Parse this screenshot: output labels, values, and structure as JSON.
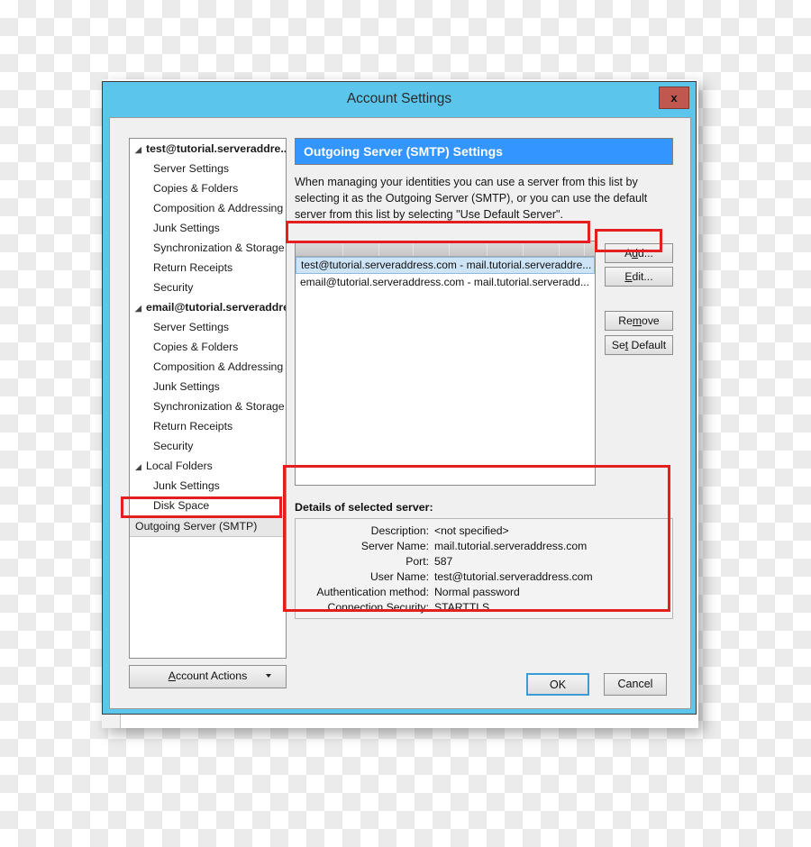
{
  "window": {
    "title": "Account Settings",
    "close_label": "x",
    "close_icon": "close-icon"
  },
  "sidebar": {
    "items": [
      {
        "label": "test@tutorial.serveraddre...",
        "type": "account",
        "twisty": "◢"
      },
      {
        "label": "Server Settings",
        "type": "child"
      },
      {
        "label": "Copies & Folders",
        "type": "child"
      },
      {
        "label": "Composition & Addressing",
        "type": "child"
      },
      {
        "label": "Junk Settings",
        "type": "child"
      },
      {
        "label": "Synchronization & Storage",
        "type": "child"
      },
      {
        "label": "Return Receipts",
        "type": "child"
      },
      {
        "label": "Security",
        "type": "child"
      },
      {
        "label": "email@tutorial.serveraddres...",
        "type": "account",
        "twisty": "◢"
      },
      {
        "label": "Server Settings",
        "type": "child"
      },
      {
        "label": "Copies & Folders",
        "type": "child"
      },
      {
        "label": "Composition & Addressing",
        "type": "child"
      },
      {
        "label": "Junk Settings",
        "type": "child"
      },
      {
        "label": "Synchronization & Storage",
        "type": "child"
      },
      {
        "label": "Return Receipts",
        "type": "child"
      },
      {
        "label": "Security",
        "type": "child"
      },
      {
        "label": "Local Folders",
        "type": "group",
        "twisty": "◢"
      },
      {
        "label": "Junk Settings",
        "type": "child"
      },
      {
        "label": "Disk Space",
        "type": "child"
      },
      {
        "label": "Outgoing Server (SMTP)",
        "type": "selected"
      }
    ],
    "account_actions": {
      "label_pre": "A",
      "label_accel": "c",
      "label_post": "count Actions",
      "full_label": "Account Actions",
      "arrow_icon": "chevron-down-icon"
    }
  },
  "main": {
    "section_title": "Outgoing Server (SMTP) Settings",
    "intro_text": "When managing your identities you can use a server from this list by selecting it as the Outgoing Server (SMTP), or you can use the default server from this list by selecting \"Use Default Server\".",
    "server_list": [
      {
        "label": "test@tutorial.serveraddress.com - mail.tutorial.serveraddre...",
        "selected": true
      },
      {
        "label": "email@tutorial.serveraddress.com - mail.tutorial.serveradd...",
        "selected": false
      }
    ],
    "buttons": {
      "add": "Add...",
      "edit": "Edit...",
      "remove": "Remove",
      "set_default": "Set Default"
    }
  },
  "details": {
    "title": "Details of selected server:",
    "rows": [
      {
        "label": "Description:",
        "value": "<not specified>"
      },
      {
        "label": "Server Name:",
        "value": "mail.tutorial.serveraddress.com"
      },
      {
        "label": "Port:",
        "value": "587"
      },
      {
        "label": "User Name:",
        "value": "test@tutorial.serveraddress.com"
      },
      {
        "label": "Authentication method:",
        "value": "Normal password"
      },
      {
        "label": "Connection Security:",
        "value": "STARTTLS"
      }
    ]
  },
  "footer": {
    "ok": "OK",
    "cancel": "Cancel"
  },
  "colors": {
    "titlebar_blue": "#5bc5ec",
    "section_blue": "#3395ff",
    "selection_blue": "#cde4f7",
    "annotation_red": "#e41f1f",
    "close_red": "#c1584f"
  }
}
